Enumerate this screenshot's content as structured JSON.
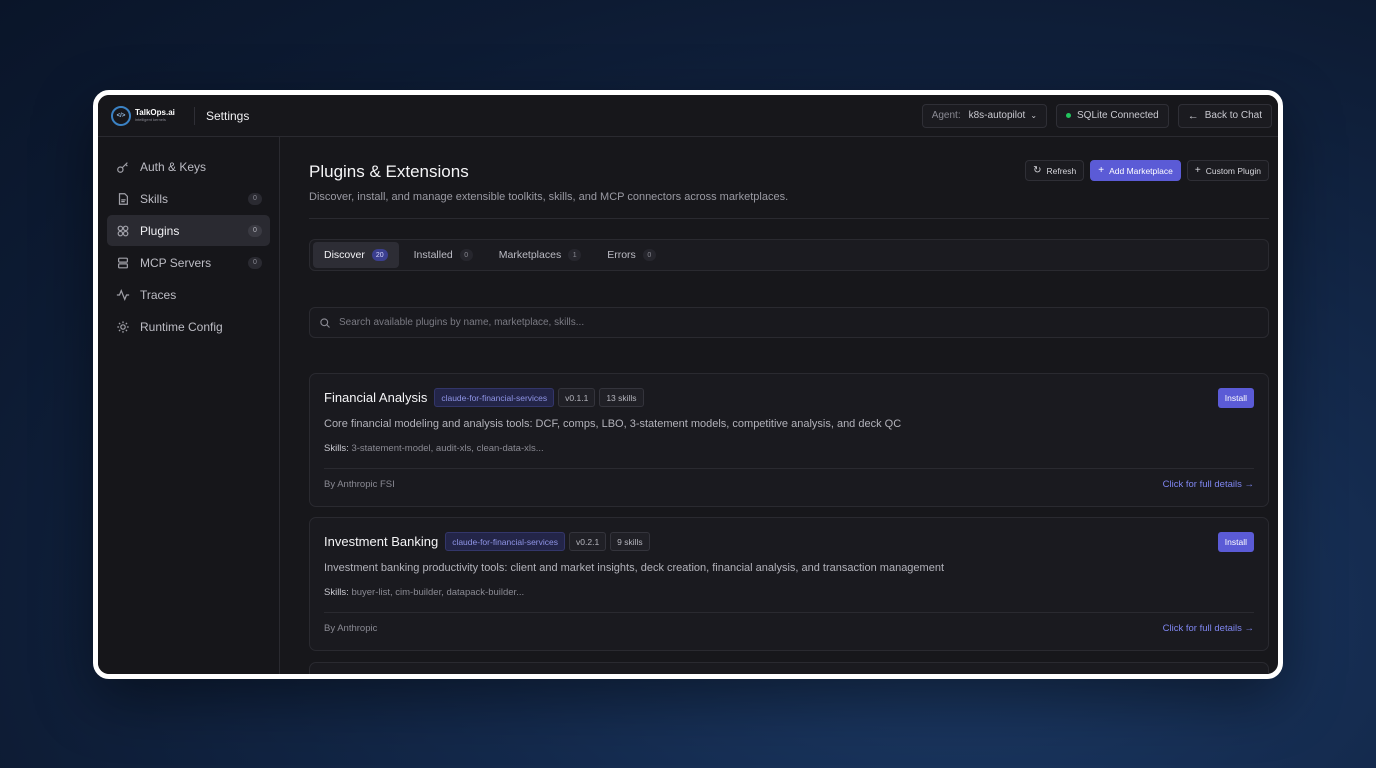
{
  "brand": {
    "name": "TalkOps.ai",
    "tagline": "intelligent kernels",
    "mark": "</>"
  },
  "header": {
    "title": "Settings",
    "agent_label": "Agent:",
    "agent_value": "k8s-autopilot",
    "db_status": "SQLite Connected",
    "back_label": "Back to Chat"
  },
  "sidebar": {
    "items": [
      {
        "label": "Auth & Keys",
        "icon": "key-icon",
        "badge": ""
      },
      {
        "label": "Skills",
        "icon": "file-icon",
        "badge": "0"
      },
      {
        "label": "Plugins",
        "icon": "plugin-icon",
        "badge": "0",
        "active": true
      },
      {
        "label": "MCP Servers",
        "icon": "server-icon",
        "badge": "0"
      },
      {
        "label": "Traces",
        "icon": "activity-icon",
        "badge": ""
      },
      {
        "label": "Runtime Config",
        "icon": "gear-icon",
        "badge": ""
      }
    ]
  },
  "page": {
    "title": "Plugins & Extensions",
    "subtitle": "Discover, install, and manage extensible toolkits, skills, and MCP connectors across marketplaces.",
    "refresh_label": "Refresh",
    "add_marketplace_label": "Add Marketplace",
    "custom_plugin_label": "Custom Plugin"
  },
  "tabs": [
    {
      "label": "Discover",
      "count": "20",
      "active": true
    },
    {
      "label": "Installed",
      "count": "0"
    },
    {
      "label": "Marketplaces",
      "count": "1"
    },
    {
      "label": "Errors",
      "count": "0"
    }
  ],
  "search": {
    "placeholder": "Search available plugins by name, marketplace, skills..."
  },
  "plugins": [
    {
      "name": "Financial Analysis",
      "marketplace": "claude-for-financial-services",
      "version": "v0.1.1",
      "skills_count": "13 skills",
      "install_label": "Install",
      "description": "Core financial modeling and analysis tools: DCF, comps, LBO, 3-statement models, competitive analysis, and deck QC",
      "skills_label": "Skills:",
      "skills": "3-statement-model, audit-xls, clean-data-xls...",
      "author": "By Anthropic FSI",
      "details_link": "Click for full details →"
    },
    {
      "name": "Investment Banking",
      "marketplace": "claude-for-financial-services",
      "version": "v0.2.1",
      "skills_count": "9 skills",
      "install_label": "Install",
      "description": "Investment banking productivity tools: client and market insights, deck creation, financial analysis, and transaction management",
      "skills_label": "Skills:",
      "skills": "buyer-list, cim-builder, datapack-builder...",
      "author": "By Anthropic",
      "details_link": "Click for full details →"
    }
  ],
  "colors": {
    "accent": "#5b5bd6",
    "status_ok": "#22c55e",
    "link": "#7f86f0"
  }
}
